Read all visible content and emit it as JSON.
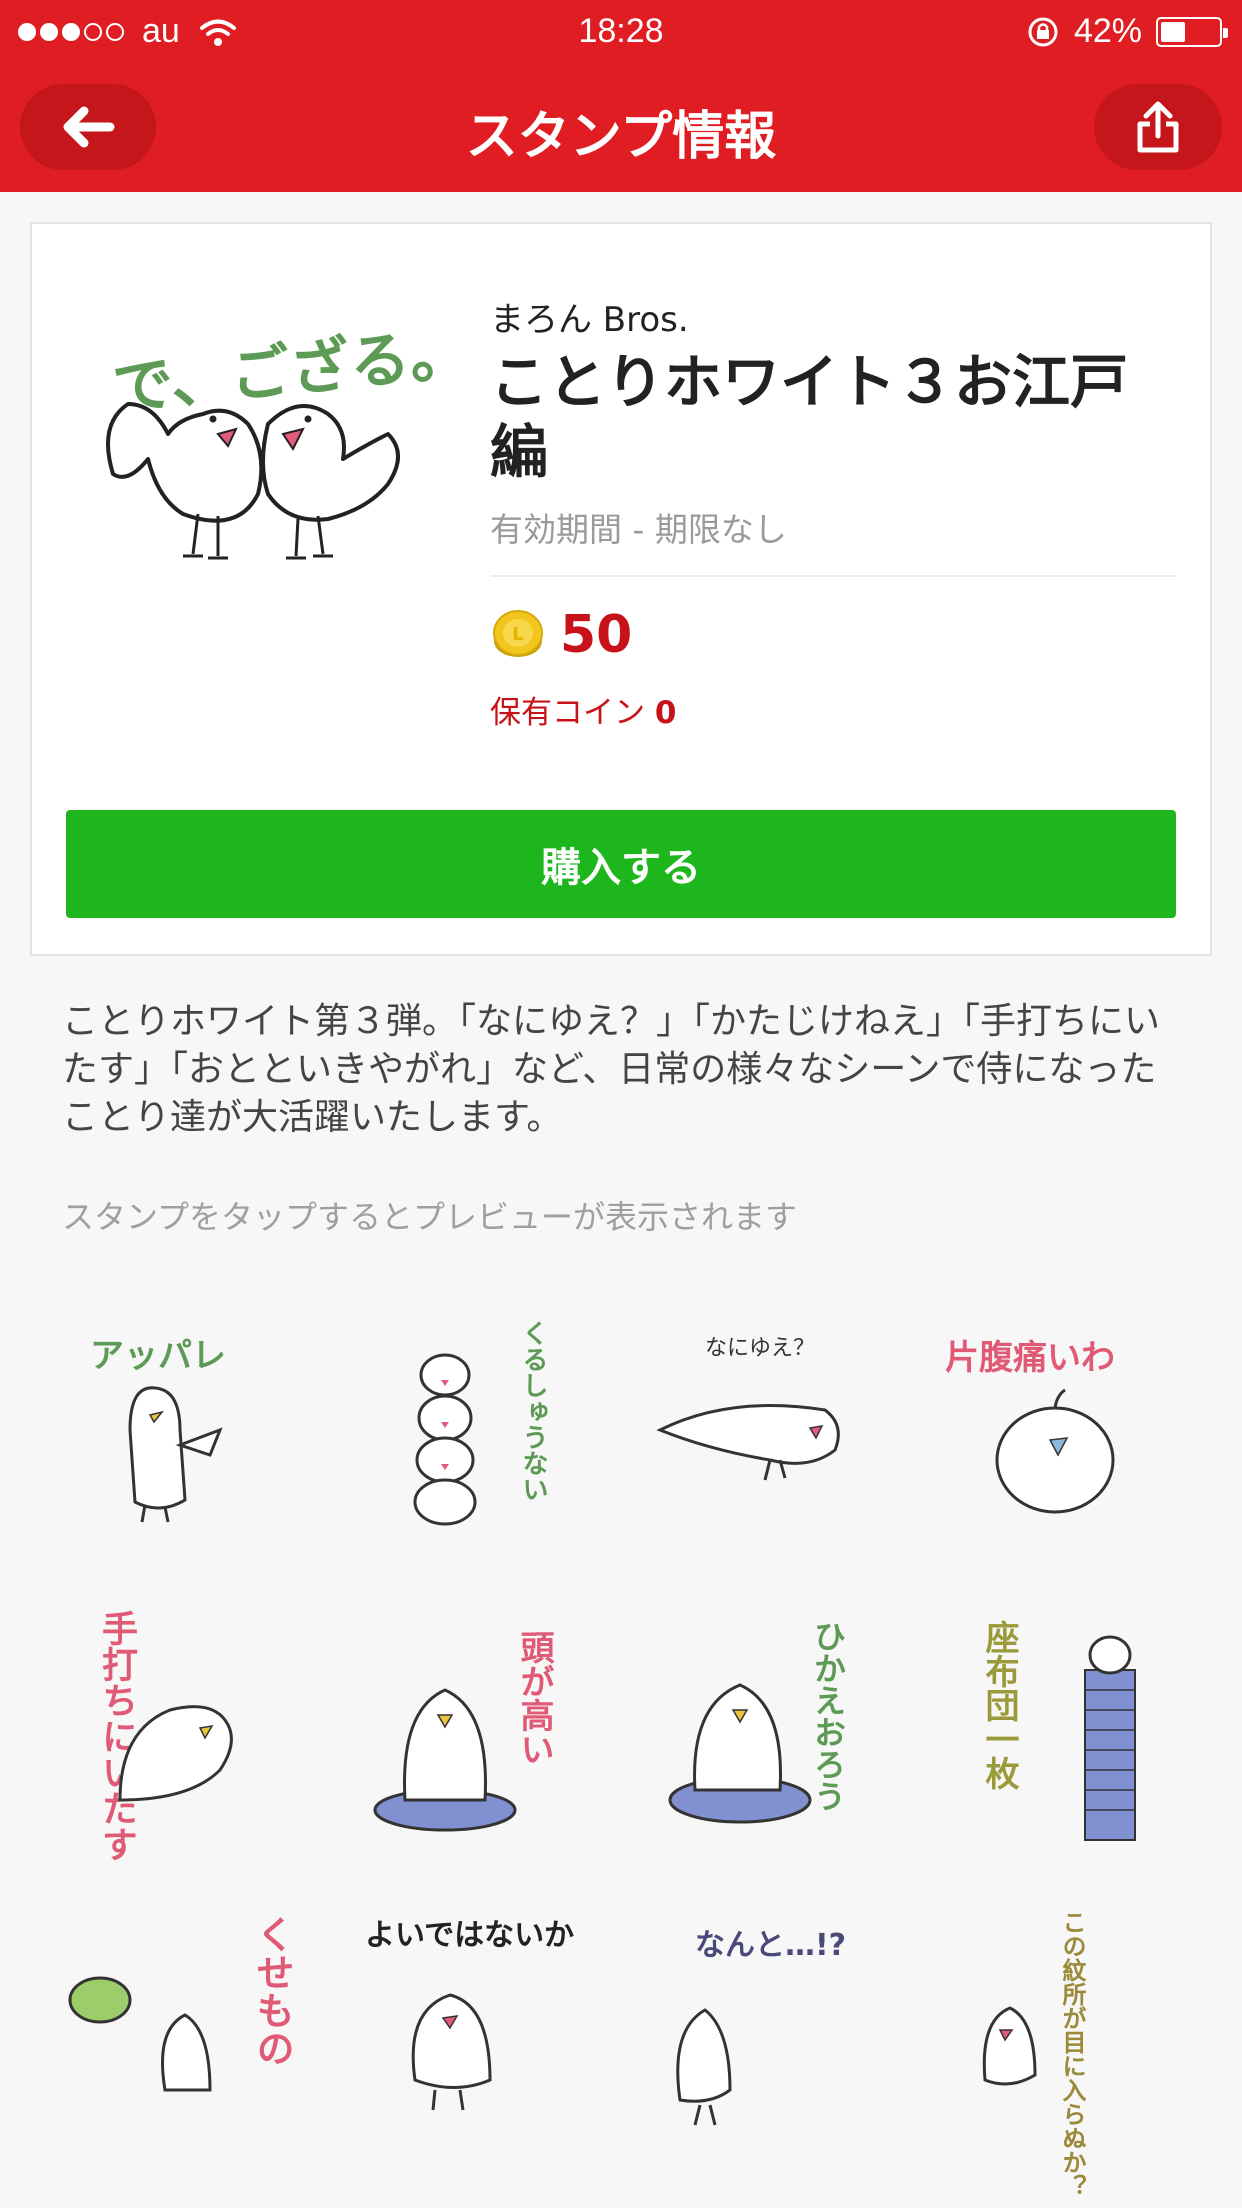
{
  "status": {
    "carrier": "au",
    "time": "18:28",
    "battery": "42%",
    "battery_level": 0.42
  },
  "header": {
    "title": "スタンプ情報"
  },
  "pack": {
    "image_text": "で、ござる。",
    "author": "まろん Bros.",
    "title": "ことりホワイト３お江戸編",
    "validity": "有効期間 - 期限なし",
    "price": "50",
    "owned_label": "保有コイン",
    "owned_value": "0",
    "buy_label": "購入する"
  },
  "description": "ことりホワイト第３弾。「なにゆえ？」「かたじけねえ」「手打ちにいたす」「おとといきやがれ」など、日常の様々なシーンで侍になったことり達が大活躍いたします。",
  "hint": "スタンプをタップするとプレビューが表示されます",
  "stickers": [
    {
      "text": "アッパレ"
    },
    {
      "text": "くるしゅうない"
    },
    {
      "text": "なにゆえ？"
    },
    {
      "text": "片腹痛いわ"
    },
    {
      "text": "手打ちにいたす"
    },
    {
      "text": "頭が高い"
    },
    {
      "text": "ひかえおろう"
    },
    {
      "text": "座布団一枚"
    },
    {
      "text": "くせもの"
    },
    {
      "text": "よいではないか"
    },
    {
      "text": "なんと…!?"
    },
    {
      "text": "この紋所が目に入らぬか？"
    }
  ],
  "colors": {
    "header": "#e01d22",
    "buy": "#1db61c",
    "price": "#c61218"
  }
}
